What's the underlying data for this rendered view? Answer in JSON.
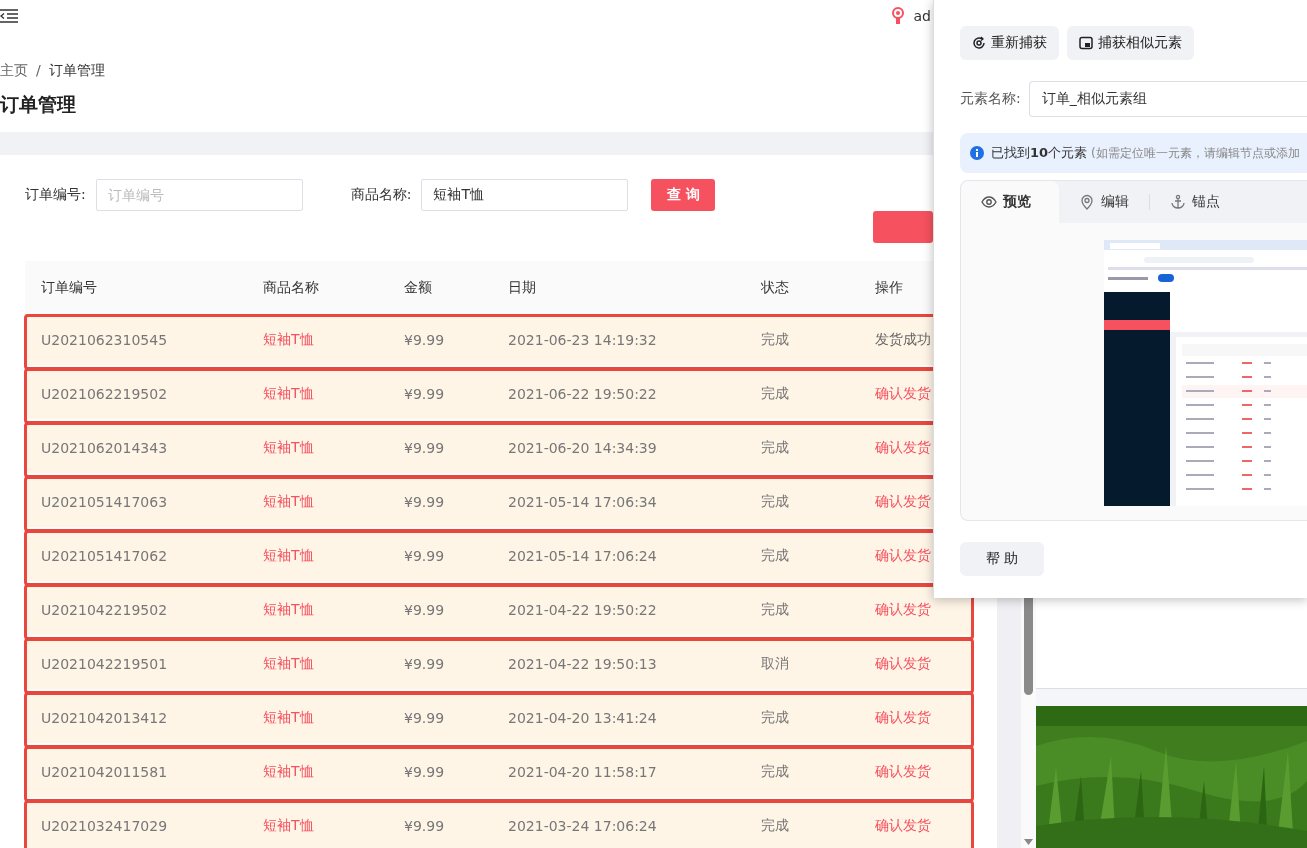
{
  "header": {
    "user": "ad"
  },
  "breadcrumb": [
    "主页",
    "/",
    "订单管理"
  ],
  "page_title": "订单管理",
  "filters": [
    {
      "label": "订单编号:",
      "placeholder": "订单编号"
    },
    {
      "label": "商品名称:",
      "value": "短袖T恤"
    }
  ],
  "query_button": "查 询",
  "table": {
    "columns": [
      "订单编号",
      "商品名称",
      "金额",
      "日期",
      "状态",
      "操作"
    ],
    "rows": [
      {
        "cells": [
          "U2021062310545",
          "短袖T恤",
          "¥9.99",
          "2021-06-23 14:19:32",
          "完成",
          "发货成功"
        ],
        "selected": true,
        "kind": "done"
      },
      {
        "cells": [
          "U2021062219502",
          "短袖T恤",
          "¥9.99",
          "2021-06-22 19:50:22",
          "完成",
          "确认发货"
        ],
        "selected": true,
        "kind": "link"
      },
      {
        "cells": [
          "U2021062014343",
          "短袖T恤",
          "¥9.99",
          "2021-06-20 14:34:39",
          "完成",
          "确认发货"
        ],
        "selected": true,
        "kind": "link"
      },
      {
        "cells": [
          "U2021051417063",
          "短袖T恤",
          "¥9.99",
          "2021-05-14 17:06:34",
          "完成",
          "确认发货"
        ],
        "selected": true,
        "kind": "link"
      },
      {
        "cells": [
          "U2021051417062",
          "短袖T恤",
          "¥9.99",
          "2021-05-14 17:06:24",
          "完成",
          "确认发货"
        ],
        "selected": true,
        "kind": "link"
      },
      {
        "cells": [
          "U2021042219502",
          "短袖T恤",
          "¥9.99",
          "2021-04-22 19:50:22",
          "完成",
          "确认发货"
        ],
        "selected": true,
        "kind": "link"
      },
      {
        "cells": [
          "U2021042219501",
          "短袖T恤",
          "¥9.99",
          "2021-04-22 19:50:13",
          "取消",
          "确认发货"
        ],
        "selected": true,
        "kind": "link"
      },
      {
        "cells": [
          "U2021042013412",
          "短袖T恤",
          "¥9.99",
          "2021-04-20 13:41:24",
          "完成",
          "确认发货"
        ],
        "selected": true,
        "kind": "link"
      },
      {
        "cells": [
          "U2021042011581",
          "短袖T恤",
          "¥9.99",
          "2021-04-20 11:58:17",
          "完成",
          "确认发货"
        ],
        "selected": true,
        "kind": "link"
      },
      {
        "cells": [
          "U2021032417029",
          "短袖T恤",
          "¥9.99",
          "2021-03-24 17:06:24",
          "完成",
          "确认发货"
        ],
        "selected": true,
        "kind": "link"
      }
    ]
  },
  "panel": {
    "buttons": [
      {
        "label": "重新捕获",
        "kind": "recapture"
      },
      {
        "label": "捕获相似元素",
        "kind": "similar"
      }
    ],
    "name_label": "元素名称:",
    "name_value": "订单_相似元素组",
    "info": "已找到**10**个元素",
    "info_hint": "(如需定位唯一元素，请编辑节点或添加",
    "tabs": [
      {
        "label": "预览",
        "kind": "eye",
        "selected": true
      },
      {
        "label": "编辑",
        "kind": "pin",
        "selected": false
      },
      {
        "label": "锚点",
        "kind": "anchor",
        "selected": false
      }
    ],
    "help_button": "帮 助"
  }
}
